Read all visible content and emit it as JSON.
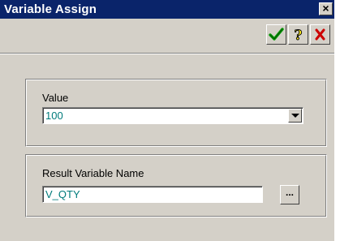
{
  "window": {
    "title": "Variable Assign"
  },
  "toolbar": {
    "ok_icon": "check-icon",
    "help_icon": "question-icon",
    "cancel_icon": "cross-icon"
  },
  "value_group": {
    "label": "Value",
    "selected": "100"
  },
  "result_group": {
    "label": "Result Variable Name",
    "value": "V_QTY",
    "browse_label": "..."
  },
  "colors": {
    "titlebar": "#0a246a",
    "dialog": "#d4d0c8",
    "field_text": "#007b7b",
    "ok_green": "#009a00",
    "help_yellow": "#f5e21a",
    "cancel_red": "#cc0000"
  }
}
